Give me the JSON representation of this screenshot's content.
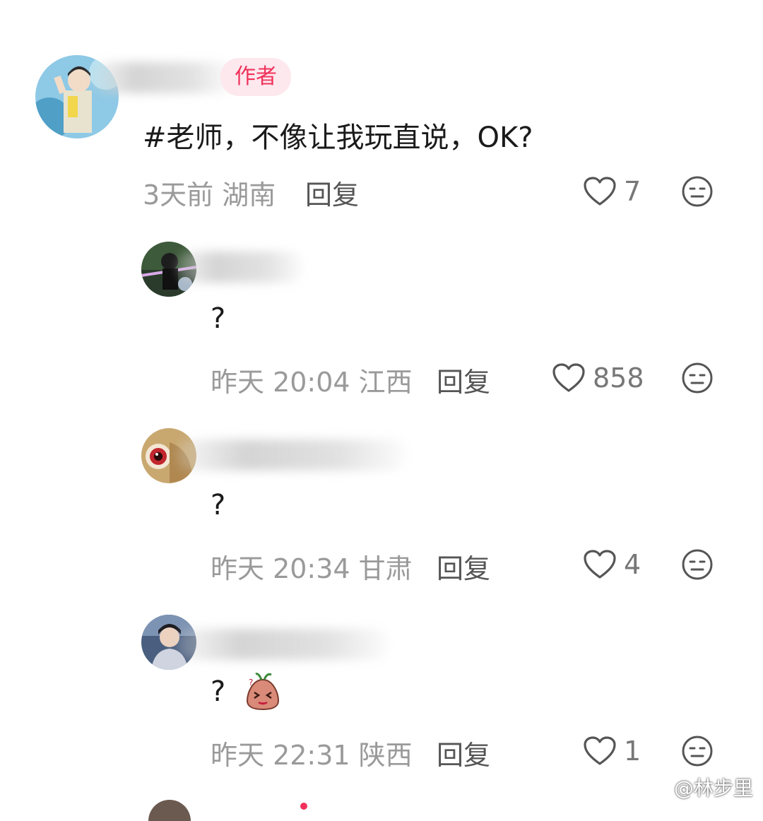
{
  "comments": [
    {
      "author_tag": "作者",
      "text": "#老师，不像让我玩直说，OK?",
      "meta": "3天前 湖南",
      "reply_label": "回复",
      "likes": "7"
    },
    {
      "text": "?",
      "meta": "昨天 20:04 江西",
      "reply_label": "回复",
      "likes": "858"
    },
    {
      "text": "?",
      "meta": "昨天 20:34 甘肃",
      "reply_label": "回复",
      "likes": "4"
    },
    {
      "text": "?",
      "meta": "昨天 22:31 陕西",
      "reply_label": "回复",
      "likes": "1"
    }
  ],
  "watermark": {
    "text": "@林步里"
  },
  "icons": {
    "like": "heart-icon",
    "dislike": "neutral-face-icon",
    "watermark": "weibo-logo-icon"
  },
  "colors": {
    "author_tag_bg": "#fde8ee",
    "author_tag_text": "#f0325a",
    "meta_text": "#9a9a9a"
  }
}
